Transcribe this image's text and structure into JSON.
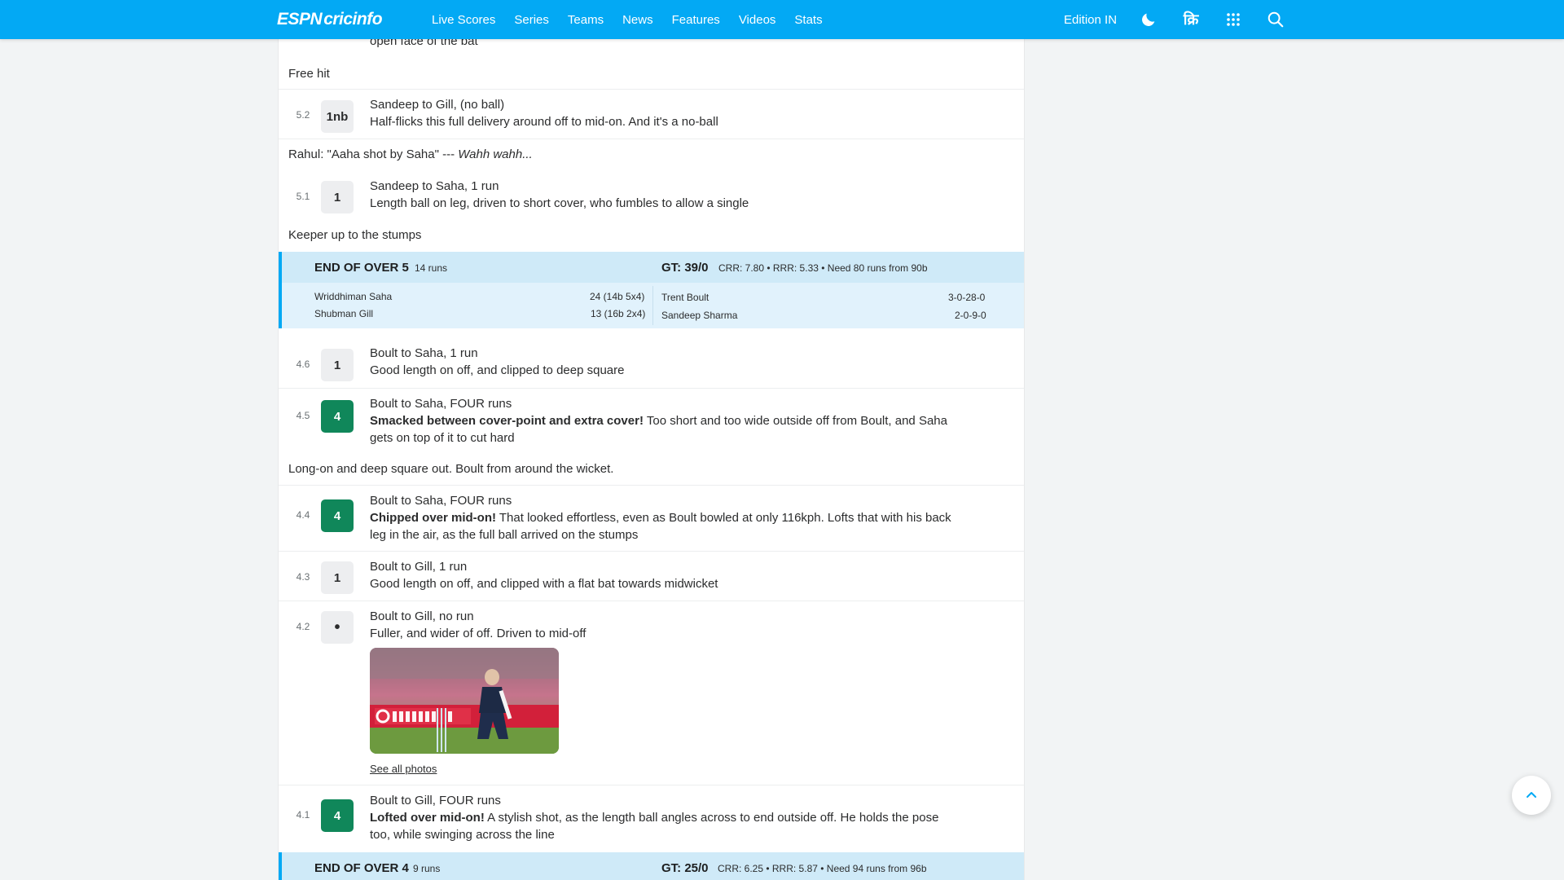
{
  "nav": {
    "logo_espn": "ESPN",
    "logo_cricinfo": "cricinfo",
    "links": [
      "Live Scores",
      "Series",
      "Teams",
      "News",
      "Features",
      "Videos",
      "Stats"
    ],
    "edition": "Edition IN",
    "hindi": "क्रि",
    "icons": [
      "moon-icon",
      "hindi-icon",
      "apps-grid-icon",
      "search-icon"
    ],
    "accent_color": "#03a9f4"
  },
  "commentary": {
    "top_cut_text": "open face of the bat",
    "free_hit": "Free hit",
    "b52": {
      "over": "5.2",
      "ball": "1nb",
      "title": "Sandeep to Gill, (no ball)",
      "text": "Half-flicks this full delivery around off to mid-on. And it's a no-ball"
    },
    "note_rahul_prefix": "Rahul: \"Aaha shot by Saha\" --- ",
    "note_rahul_italic": "Wahh wahh...",
    "b51": {
      "over": "5.1",
      "ball": "1",
      "title": "Sandeep to Saha, 1 run",
      "text": "Length ball on leg, driven to short cover, who fumbles to allow a single"
    },
    "note_keeper": "Keeper up to the stumps",
    "eoo5": {
      "title": "END OF OVER 5",
      "runs": "14 runs",
      "score": "GT: 39/0",
      "stats": "CRR: 7.80 • RRR: 5.33 • Need 80 runs from 90b",
      "bat1": "Wriddhiman Saha",
      "bat1_fig": "24 (14b 5x4)",
      "bat2": "Shubman Gill",
      "bat2_fig": "13 (16b 2x4)",
      "bowl1": "Trent Boult",
      "bowl1_fig": "3-0-28-0",
      "bowl2": "Sandeep Sharma",
      "bowl2_fig": "2-0-9-0"
    },
    "b46": {
      "over": "4.6",
      "ball": "1",
      "title": "Boult to Saha, 1 run",
      "text": "Good length on off, and clipped to deep square"
    },
    "b45": {
      "over": "4.5",
      "ball": "4",
      "title": "Boult to Saha, FOUR runs",
      "bold": "Smacked between cover-point and extra cover!",
      "text": " Too short and too wide outside off from Boult, and Saha gets on top of it to cut hard"
    },
    "note_longon": "Long-on and deep square out. Boult from around the wicket.",
    "b44": {
      "over": "4.4",
      "ball": "4",
      "title": "Boult to Saha, FOUR runs",
      "bold": "Chipped over mid-on!",
      "text": " That looked effortless, even as Boult bowled at only 116kph. Lofts that with his back leg in the air, as the full ball arrived on the stumps"
    },
    "b43": {
      "over": "4.3",
      "ball": "1",
      "title": "Boult to Gill, 1 run",
      "text": "Good length on off, and clipped with a flat bat towards midwicket"
    },
    "b42": {
      "over": "4.2",
      "ball": "•",
      "title": "Boult to Gill, no run",
      "text": "Fuller, and wider of off. Driven to mid-off",
      "see_all": "See all photos"
    },
    "b41": {
      "over": "4.1",
      "ball": "4",
      "title": "Boult to Gill, FOUR runs",
      "bold": "Lofted over mid-on!",
      "text": " A stylish shot, as the length ball angles across to end outside off. He holds the pose too, while swinging across the line"
    },
    "eoo4": {
      "title": "END OF OVER 4",
      "runs": "9 runs",
      "score": "GT: 25/0",
      "stats": "CRR: 6.25 • RRR: 5.87 • Need 94 runs from 96b"
    }
  },
  "colors": {
    "four": "#10875a",
    "eoo_header": "#cfeaf8",
    "eoo_body": "#e1f2fc"
  }
}
